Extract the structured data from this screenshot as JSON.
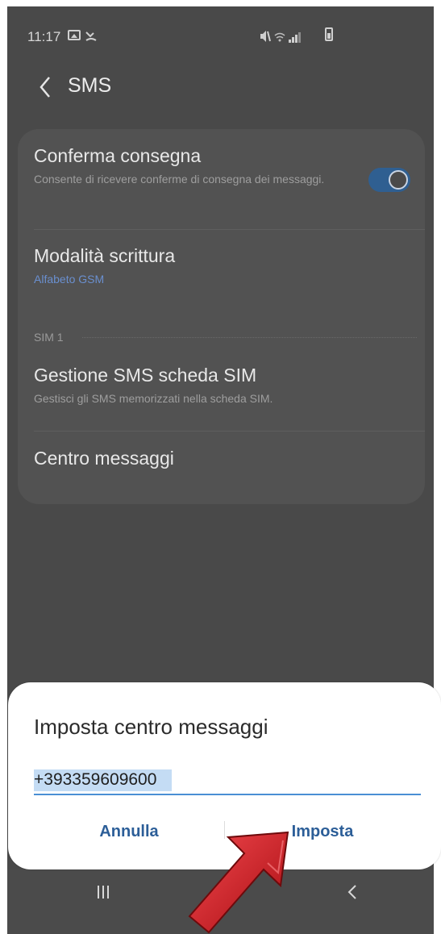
{
  "status_bar": {
    "time": "11:17",
    "icons": [
      "gallery-icon",
      "missed-call-icon",
      "mute-icon",
      "wifi-icon",
      "signal-icon",
      "battery-icon"
    ]
  },
  "header": {
    "title": "SMS",
    "back_icon": "chevron-left-icon"
  },
  "settings": {
    "delivery_report": {
      "title": "Conferma consegna",
      "subtitle": "Consente di ricevere conferme di consegna dei messaggi.",
      "toggle_on": true
    },
    "input_mode": {
      "title": "Modalità scrittura",
      "value": "Alfabeto GSM"
    },
    "section_label": "SIM 1",
    "manage_sim": {
      "title": "Gestione SMS scheda SIM",
      "subtitle": "Gestisci gli SMS memorizzati nella scheda SIM."
    },
    "message_center": {
      "title": "Centro messaggi"
    }
  },
  "dialog": {
    "title": "Imposta centro messaggi",
    "input_value": "+393359609600",
    "cancel_label": "Annulla",
    "confirm_label": "Imposta"
  },
  "nav_bar": {
    "icons": [
      "recents-icon",
      "home-icon",
      "back-icon"
    ]
  },
  "colors": {
    "overlay_background": "#494949",
    "card_background": "#525252",
    "accent_blue": "#2c5e98",
    "input_underline": "#4a8fd4",
    "annotation_arrow": "#d4151c"
  }
}
